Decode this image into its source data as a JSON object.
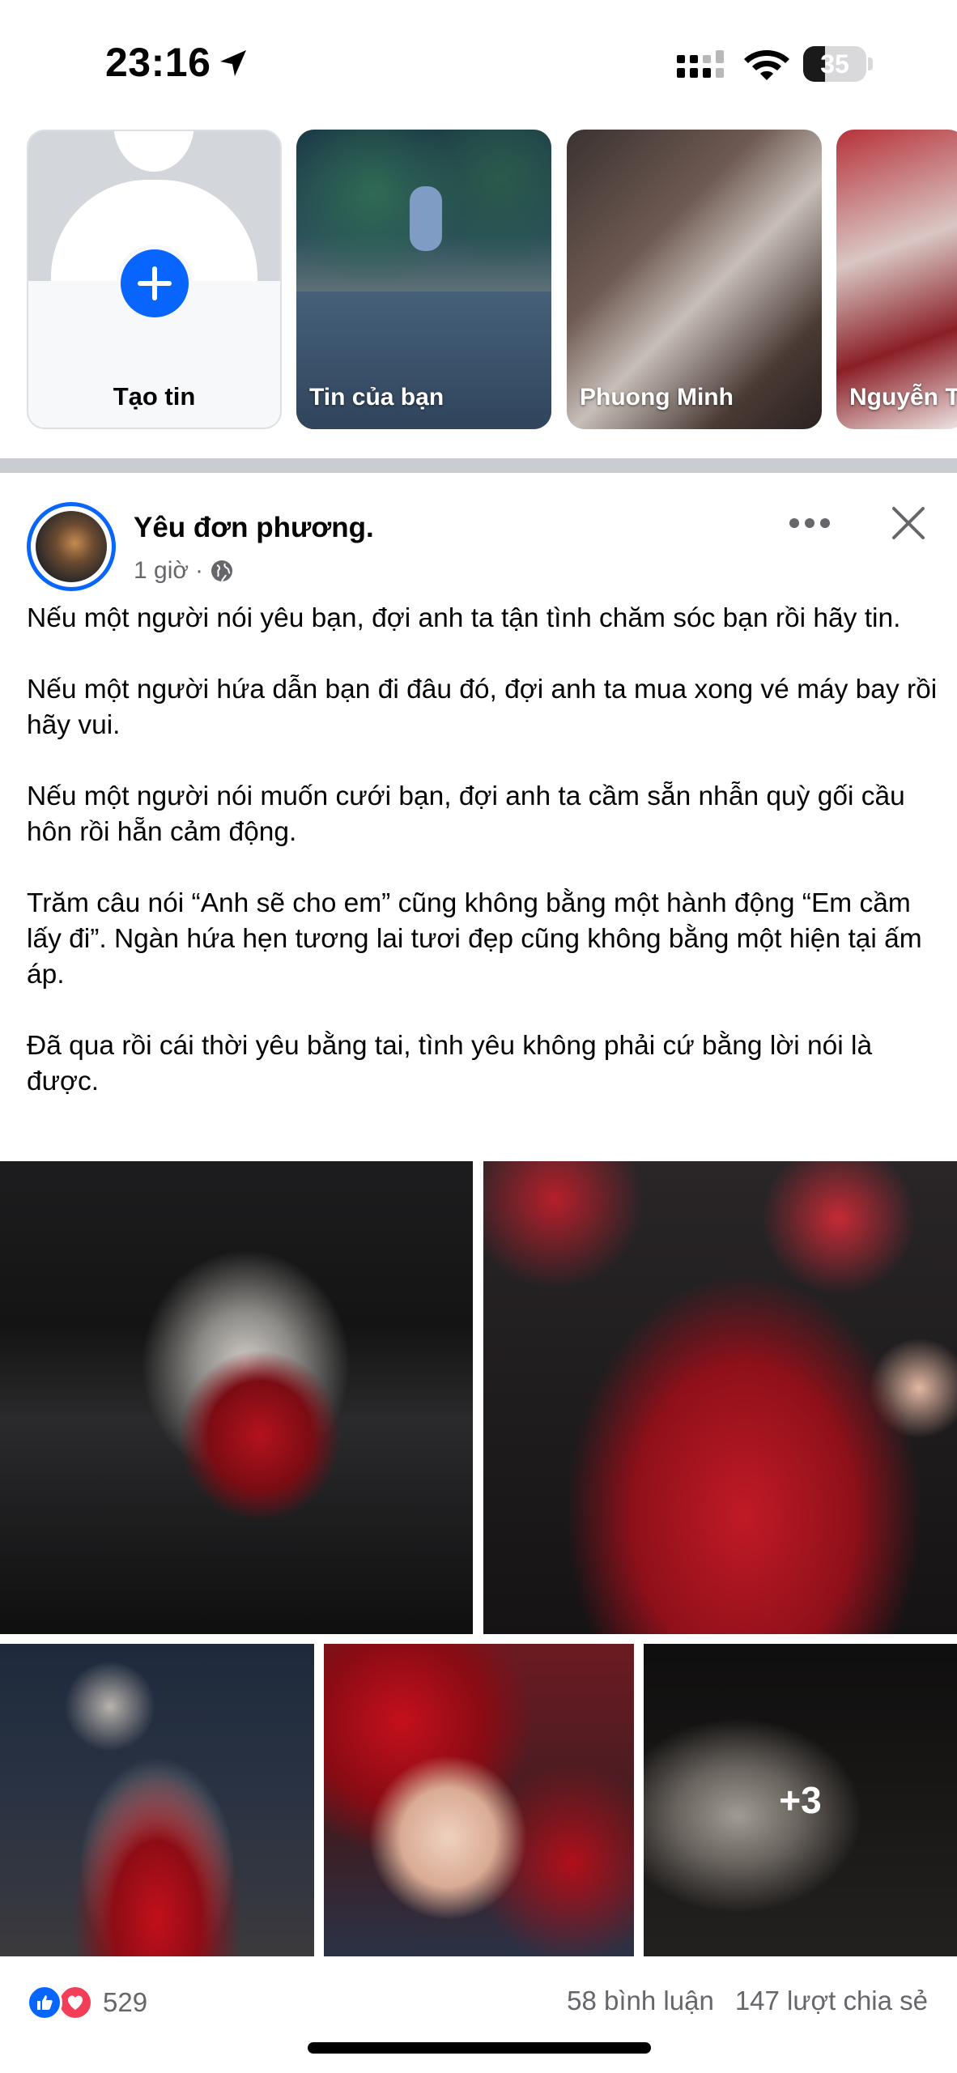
{
  "status_bar": {
    "time": "23:16",
    "battery": "35",
    "icons": [
      "location-arrow-icon",
      "signal-icon",
      "wifi-icon",
      "battery-icon"
    ]
  },
  "stories": [
    {
      "label": "Tạo tin",
      "type": "create"
    },
    {
      "label": "Tin của bạn"
    },
    {
      "label": "Phuong Minh"
    },
    {
      "label": "Nguyễn T"
    }
  ],
  "post": {
    "author": "Yêu đơn phương.",
    "time": "1 giờ",
    "separator": "·",
    "paragraphs": [
      "Nếu một người nói yêu bạn, đợi anh ta tận tình chăm sóc bạn rồi hãy tin.",
      "Nếu một người hứa dẫn bạn đi đâu đó, đợi anh ta mua xong vé máy bay rồi hãy vui.",
      "Nếu một người nói muốn cưới bạn, đợi anh ta cầm sẵn nhẫn quỳ gối cầu hôn rồi hẵn cảm động.",
      "Trăm câu nói “Anh sẽ cho em” cũng không bằng một hành động “Em cầm lấy đi”. Ngàn hứa hẹn tương lai tươi đẹp cũng không bằng một hiện tại ấm áp.",
      "Đã qua rồi cái thời yêu bằng tai, tình yêu không phải cứ bằng lời nói là được."
    ],
    "more_photos": "+3",
    "reaction_count": "529",
    "comments": "58 bình luận",
    "shares": "147 lượt chia sẻ"
  },
  "colors": {
    "accent": "#0866ff",
    "love": "#f33e58",
    "secondary_text": "#65676b",
    "divider": "#c9ccd1"
  }
}
